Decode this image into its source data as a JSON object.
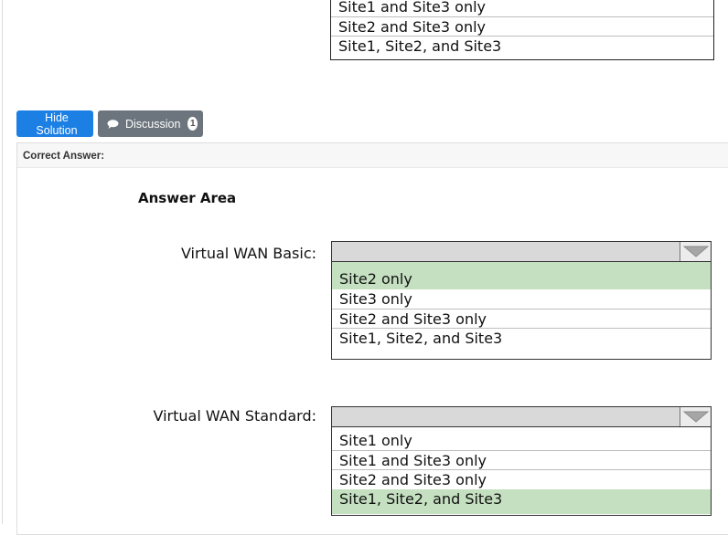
{
  "previous_question": {
    "options": [
      "Site1 and Site3 only",
      "Site2 and Site3 only",
      "Site1, Site2, and Site3"
    ]
  },
  "buttons": {
    "hide_solution": "Hide Solution",
    "discussion": "Discussion",
    "discussion_count": "1"
  },
  "panel": {
    "title": "Correct Answer:",
    "answer_area": "Answer Area",
    "rows": [
      {
        "label": "Virtual WAN Basic:",
        "options": [
          "Site2 only",
          "Site3 only",
          "Site2 and Site3 only",
          "Site1, Site2, and Site3"
        ],
        "correct_option": "Site2 only"
      },
      {
        "label": "Virtual WAN Standard:",
        "options": [
          "Site1 only",
          "Site1 and Site3 only",
          "Site2 and Site3 only",
          "Site1, Site2, and Site3"
        ],
        "correct_option": "Site1, Site2, and Site3"
      }
    ]
  },
  "colors": {
    "primary_button": "#1b7fe3",
    "secondary_button": "#6c757d",
    "correct_highlight": "#c5e0c1",
    "dropdown_header": "#d9d9d9"
  },
  "icons": [
    "comment-icon",
    "dropdown-arrow-icon"
  ]
}
